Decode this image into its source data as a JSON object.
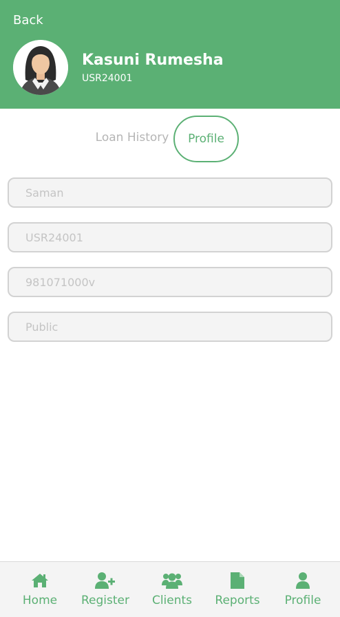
{
  "header": {
    "back_label": "Back",
    "user_name": "Kasuni Rumesha",
    "user_id": "USR24001",
    "avatar_icon": "woman-avatar-icon"
  },
  "tabs": [
    {
      "label": "Loan History",
      "active": false
    },
    {
      "label": "Profile",
      "active": true
    }
  ],
  "profile_fields": [
    {
      "placeholder": "Saman"
    },
    {
      "placeholder": "USR24001"
    },
    {
      "placeholder": "981071000v"
    },
    {
      "placeholder": "Public"
    }
  ],
  "bottom_nav": [
    {
      "label": "Home",
      "icon": "home-icon"
    },
    {
      "label": "Register",
      "icon": "user-plus-icon"
    },
    {
      "label": "Clients",
      "icon": "users-icon"
    },
    {
      "label": "Reports",
      "icon": "file-icon"
    },
    {
      "label": "Profile",
      "icon": "user-icon"
    }
  ],
  "colors": {
    "primary": "#5bb074",
    "field_bg": "#f4f4f4",
    "field_border": "#d2d2d2",
    "placeholder": "#c4c4c4"
  }
}
